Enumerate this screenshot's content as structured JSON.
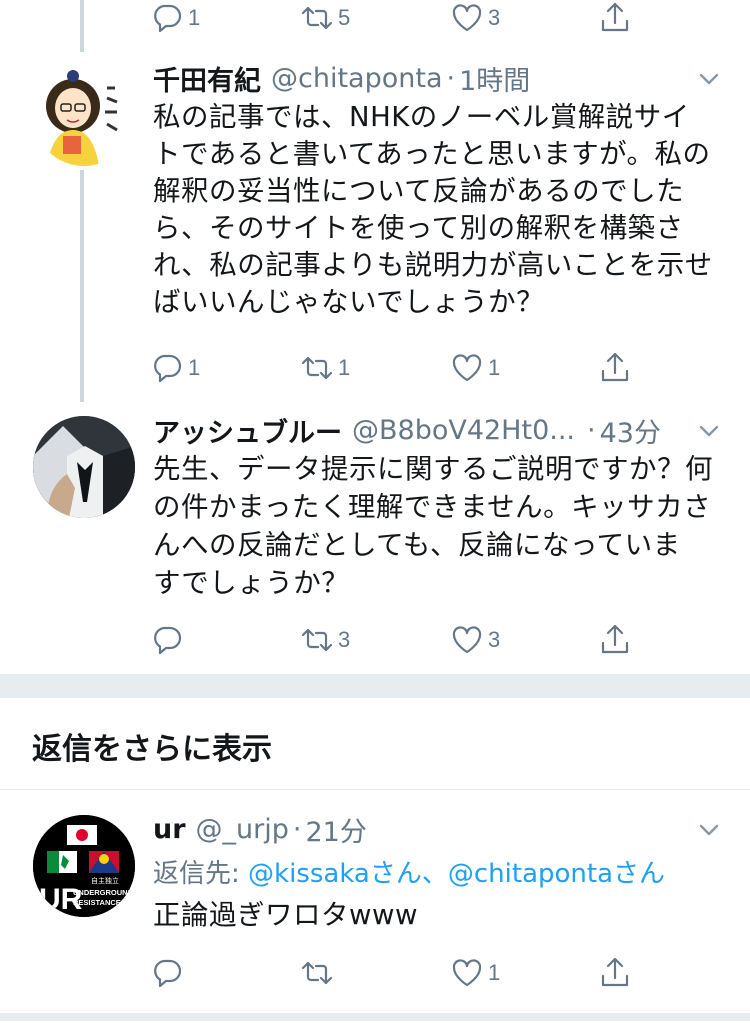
{
  "top_actions": {
    "reply": "1",
    "retweet": "5",
    "like": "3"
  },
  "tweets": [
    {
      "name": "千田有紀",
      "handle": "@chitaponta",
      "time": "1時間",
      "lines": [
        "私の記事では、NHKのノーベル賞解説サイ",
        "トであると書いてあったと思いますが。私の",
        "解釈の妥当性について反論があるのでした",
        "ら、そのサイトを使って別の解釈を構築さ",
        "れ、私の記事よりも説明力が高いことを示せ",
        "ばいいんじゃないでしょうか？"
      ],
      "reply": "1",
      "retweet": "1",
      "like": "1"
    },
    {
      "name": "アッシュブルー",
      "handle": "@B8boV42Ht0...",
      "time": "43分",
      "lines": [
        "先生、データ提示に関するご説明ですか？何",
        "の件かまったく理解できません。キッサカさ",
        "んへの反論だとしても、反論になっていま",
        "すでしょうか？"
      ],
      "reply": "",
      "retweet": "3",
      "like": "3"
    },
    {
      "name": "ur",
      "handle": "@_urjp",
      "time": "21分",
      "replying_prefix": "返信先: ",
      "mentions": [
        "@kissakaさん",
        "、",
        "@chitapontaさん"
      ],
      "lines": [
        "正論過ぎワロタwww"
      ],
      "reply": "",
      "retweet": "",
      "like": "1"
    }
  ],
  "more_replies_label": "返信をさらに表示",
  "avatar3_text": {
    "line1": "自主独立",
    "line2": "UNDERGROUND",
    "line3": "RESISTANCE",
    "big": "UR"
  },
  "colors": {
    "accent": "#1da1f2",
    "muted": "#657786",
    "divider": "#e6ecf0",
    "thread": "#ccd6dd"
  },
  "icons": [
    "reply-icon",
    "retweet-icon",
    "like-icon",
    "share-icon",
    "chevron-down-icon"
  ]
}
